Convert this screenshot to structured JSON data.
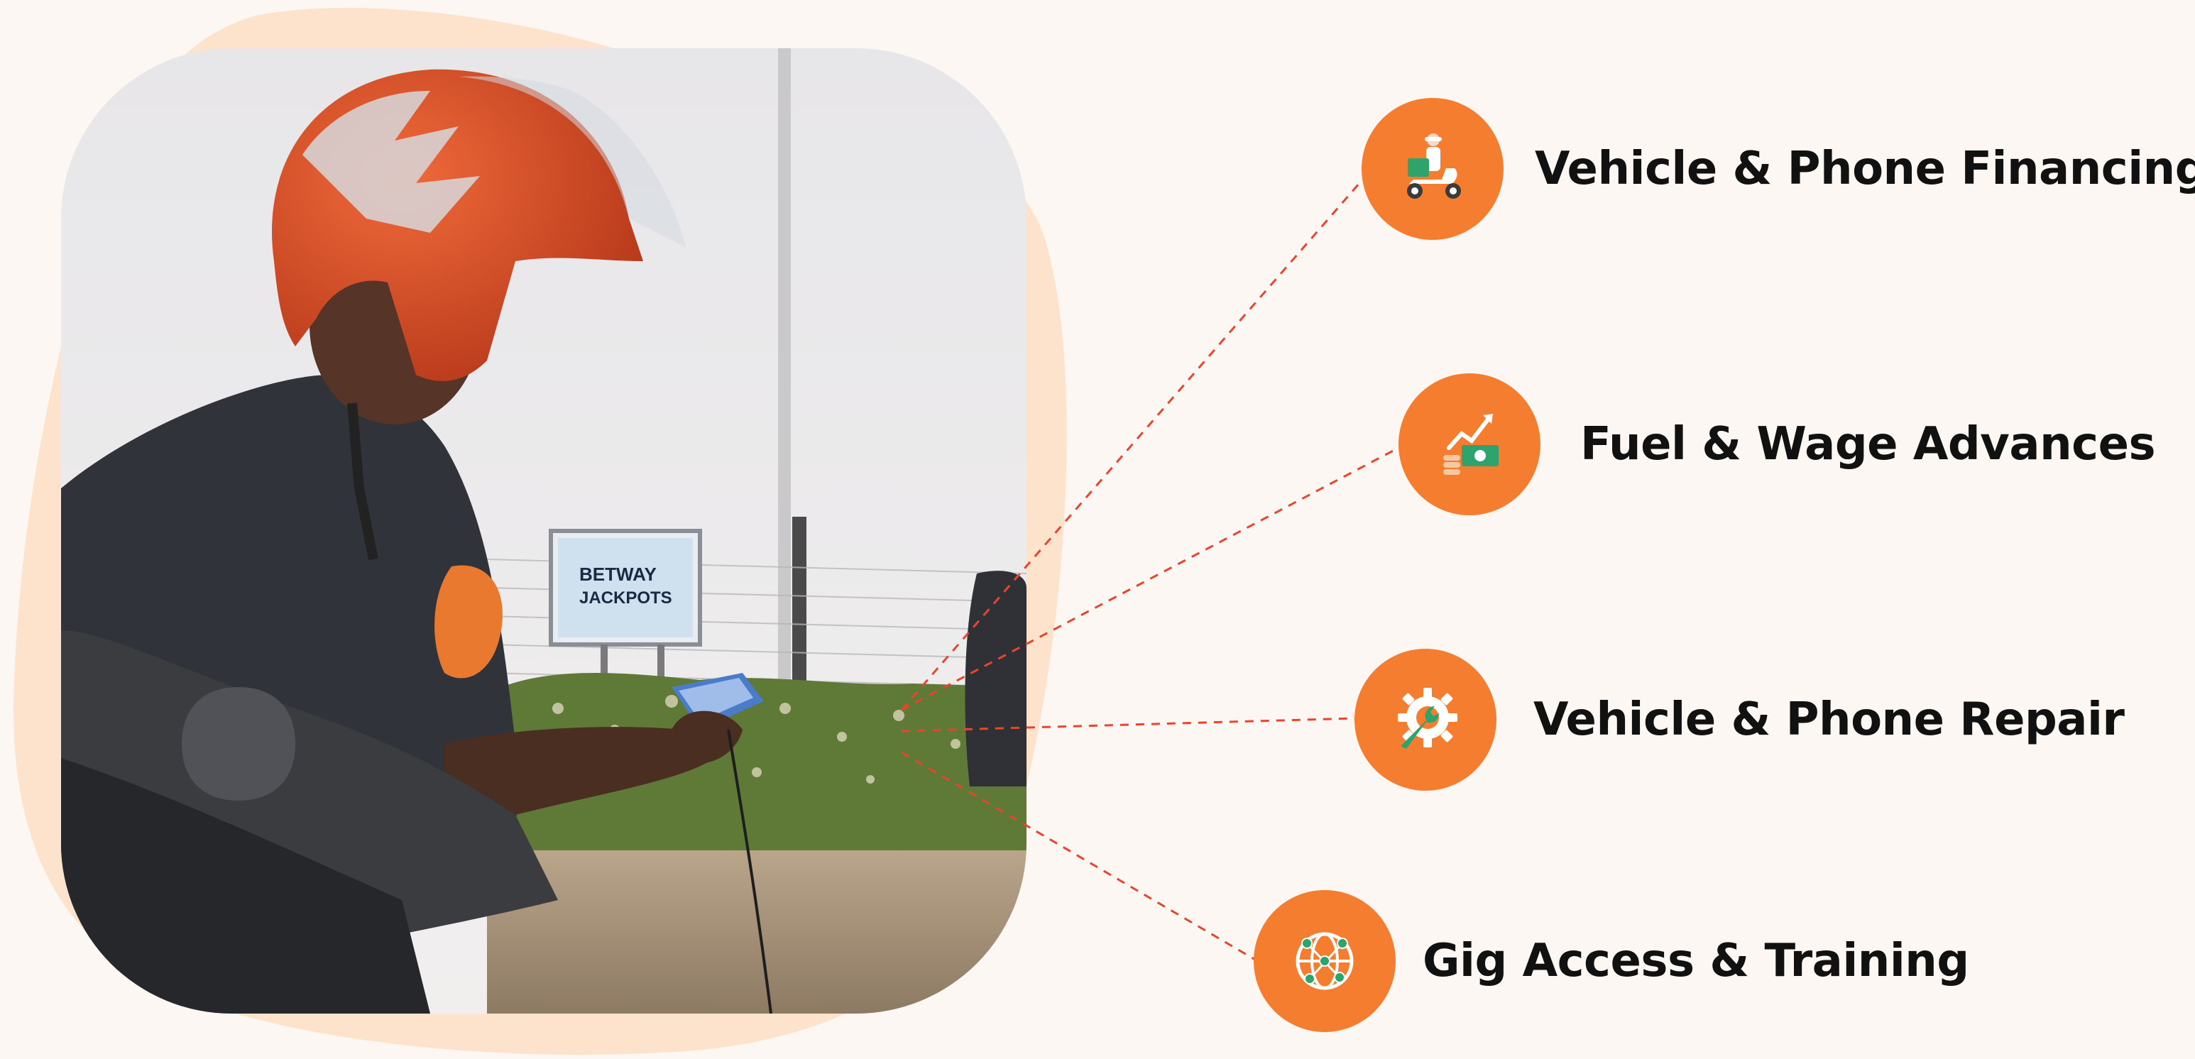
{
  "colors": {
    "background": "#fdf7f3",
    "blob": "#fde3cc",
    "accent_orange": "#f47d2f",
    "connector": "#e8452f",
    "label_text": "#111111"
  },
  "photo": {
    "billboard_line1": "BETWAY",
    "billboard_line2": "JACKPOTS"
  },
  "services": [
    {
      "label": "Vehicle & Phone Financing",
      "icon": "delivery-scooter-icon"
    },
    {
      "label": "Fuel & Wage Advances",
      "icon": "money-growth-icon"
    },
    {
      "label": "Vehicle & Phone Repair",
      "icon": "gear-wrench-icon"
    },
    {
      "label": "Gig Access & Training",
      "icon": "network-globe-icon"
    }
  ]
}
